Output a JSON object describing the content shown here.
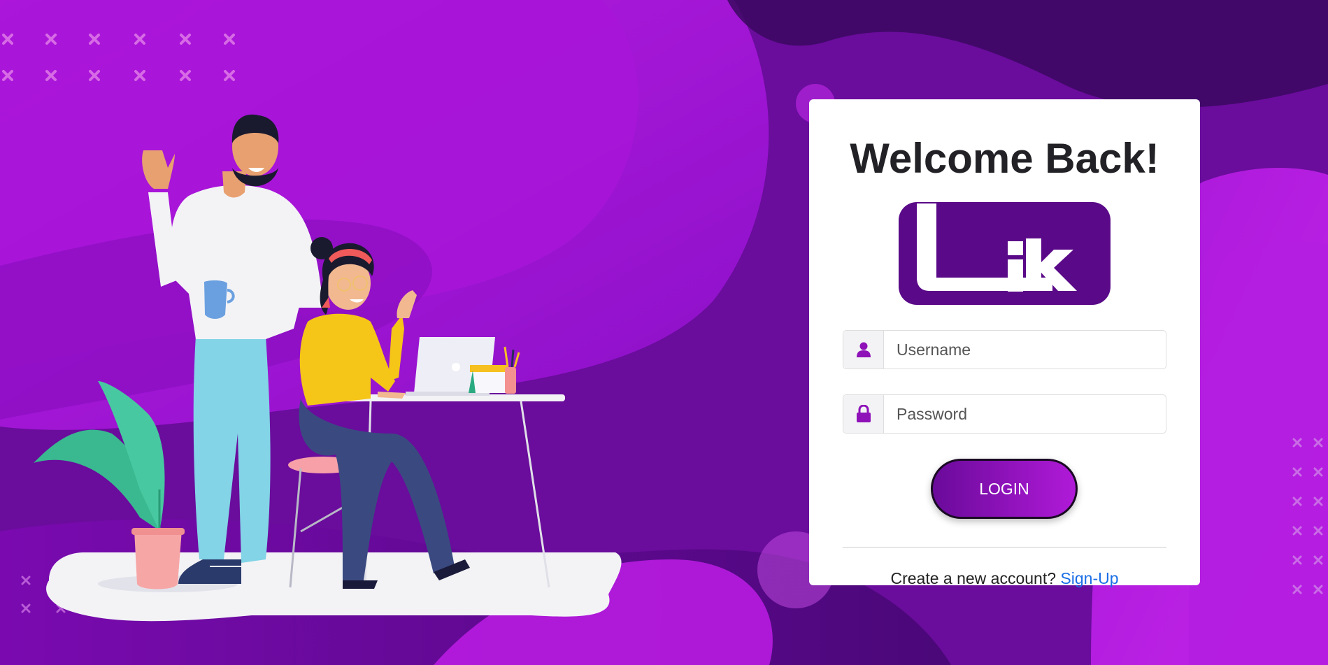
{
  "login_card": {
    "title": "Welcome Back!",
    "logo_text": "Lik",
    "username": {
      "value": "",
      "placeholder": "Username",
      "icon": "user-icon"
    },
    "password": {
      "value": "",
      "placeholder": "Password",
      "icon": "lock-icon"
    },
    "login_label": "LOGIN",
    "signup_prompt": "Create a new account?",
    "signup_link": "Sign-Up"
  },
  "colors": {
    "accent": "#9b12d6",
    "accent_dark": "#5a0a8c",
    "link": "#1a6ee6",
    "text_dark": "#222226"
  }
}
